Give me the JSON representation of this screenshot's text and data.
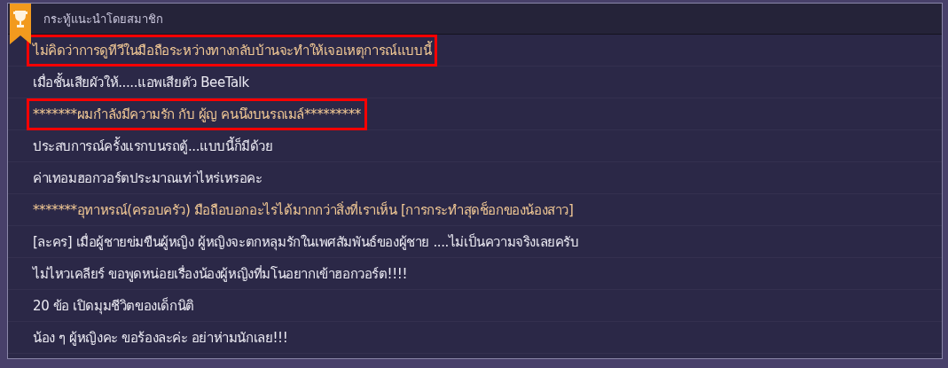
{
  "panel": {
    "title": "กระทู้แนะนำโดยสมาชิก"
  },
  "topics": [
    {
      "text": "ไม่คิดว่าการดูทีวีในมือถือระหว่างทางกลับบ้านจะทำให้เจอเหตุการณ์แบบนี้",
      "highlighted": true,
      "boxed": true
    },
    {
      "text": "เมื่อชั้นเสียผัวให้.....แอพเสียตัว BeeTalk",
      "highlighted": false,
      "boxed": false
    },
    {
      "text": "*******ผมกำลังมีความรัก กับ ผู้ญ คนนึงบนรถเมล์*********",
      "highlighted": true,
      "boxed": true
    },
    {
      "text": "ประสบการณ์ครั้งแรกบนรถตู้...แบบนี้ก็มีด้วย",
      "highlighted": false,
      "boxed": false
    },
    {
      "text": "ค่าเทอมฮอกวอร์ตประมาณเท่าไหร่เหรอคะ",
      "highlighted": false,
      "boxed": false
    },
    {
      "text": "*******อุทาหรณ์(ครอบครัว) มือถือบอกอะไรได้มากกว่าสิ่งที่เราเห็น [การกระทำสุดช็อกของน้องสาว]",
      "highlighted": true,
      "boxed": false
    },
    {
      "text": "[ละคร] เมื่อผู้ชายข่มขืนผู้หญิง ผู้หญิงจะตกหลุมรักในเพศสัมพันธ์ของผู้ชาย ....ไม่เป็นความจริงเลยครับ",
      "highlighted": false,
      "boxed": false
    },
    {
      "text": "ไม่ไหวเคลียร์ ขอพูดหน่อยเรื่องน้องผู้หญิงที่มโนอยากเข้าฮอกวอร์ต!!!!",
      "highlighted": false,
      "boxed": false
    },
    {
      "text": "20 ข้อ เปิดมุมชีวิตของเด็กนิติ",
      "highlighted": false,
      "boxed": false
    },
    {
      "text": "น้อง ๆ ผู้หญิงคะ ขอร้องละค่ะ อย่าห่ามนักเลย!!!",
      "highlighted": false,
      "boxed": false
    }
  ]
}
